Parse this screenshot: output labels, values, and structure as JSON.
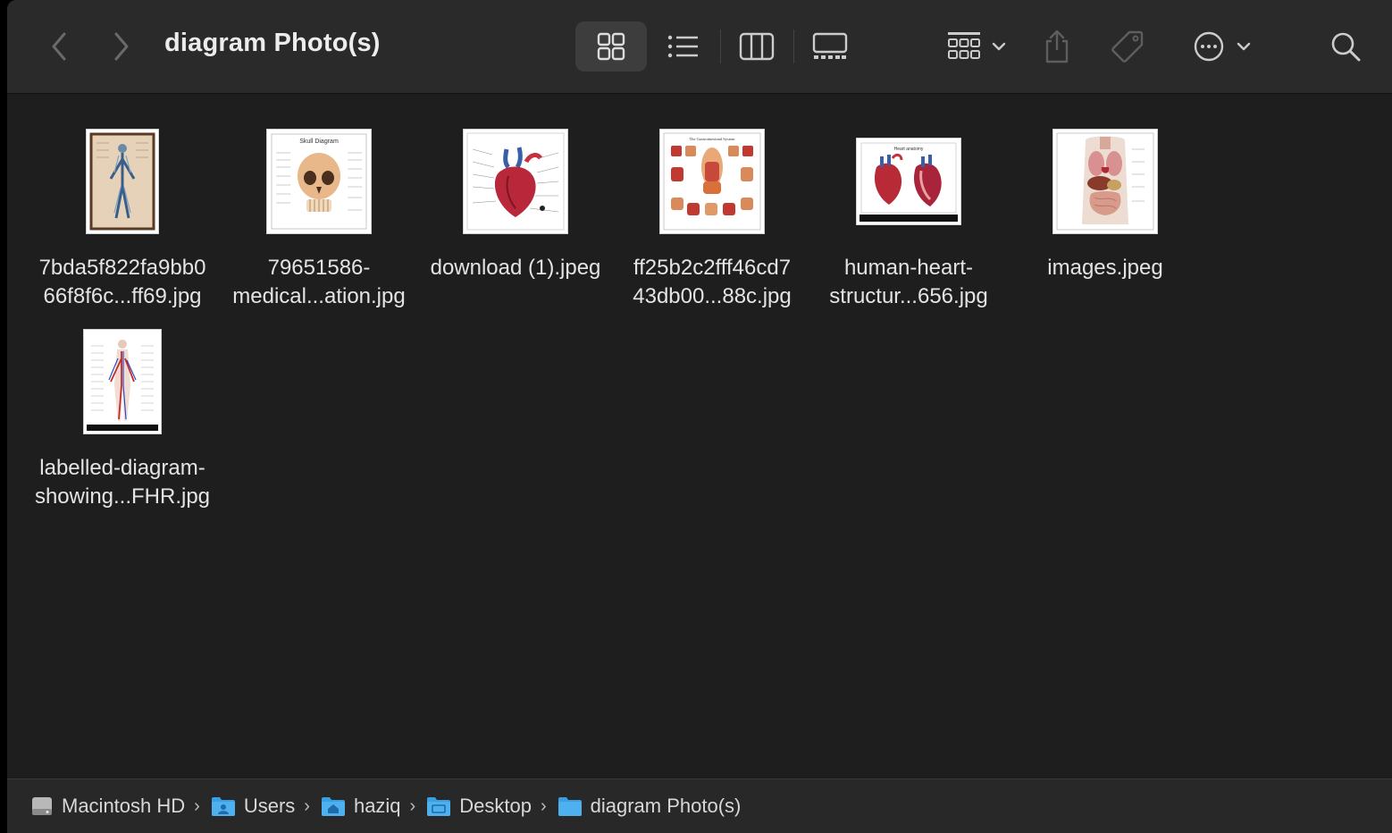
{
  "window": {
    "title": "diagram Photo(s)"
  },
  "toolbar": {
    "icons": [
      "back-icon",
      "forward-icon",
      "icon-view-icon",
      "list-view-icon",
      "column-view-icon",
      "gallery-view-icon",
      "group-icon",
      "share-icon",
      "tag-icon",
      "more-icon",
      "search-icon"
    ]
  },
  "files": [
    {
      "line1": "7bda5f822fa9bb0",
      "line2": "66f8f6c...ff69.jpg",
      "thumb": "body-vessels"
    },
    {
      "line1": "79651586-",
      "line2": "medical...ation.jpg",
      "thumb": "skull"
    },
    {
      "line1": "download (1).jpeg",
      "line2": "",
      "thumb": "heart"
    },
    {
      "line1": "ff25b2c2fff46cd7",
      "line2": "43db00...88c.jpg",
      "thumb": "gastro"
    },
    {
      "line1": "human-heart-",
      "line2": "structur...656.jpg",
      "thumb": "heart-anatomy"
    },
    {
      "line1": "images.jpeg",
      "line2": "",
      "thumb": "torso"
    },
    {
      "line1": "labelled-diagram-",
      "line2": "showing...FHR.jpg",
      "thumb": "circulation"
    }
  ],
  "thumb_text": {
    "skull_title": "Skull Diagram",
    "heart_anatomy_title": "Heart anatomy",
    "gastro_title": "The Gastrointestinal System"
  },
  "pathbar": {
    "items": [
      {
        "label": "Macintosh HD",
        "icon": "disk-icon"
      },
      {
        "label": "Users",
        "icon": "users-folder-icon"
      },
      {
        "label": "haziq",
        "icon": "home-folder-icon"
      },
      {
        "label": "Desktop",
        "icon": "desktop-folder-icon"
      },
      {
        "label": "diagram Photo(s)",
        "icon": "folder-icon"
      }
    ],
    "separator": "›"
  },
  "colors": {
    "accent_folder": "#3aa0e6",
    "window_bg": "#1e1e1e",
    "toolbar_bg": "#2a2a2a"
  }
}
